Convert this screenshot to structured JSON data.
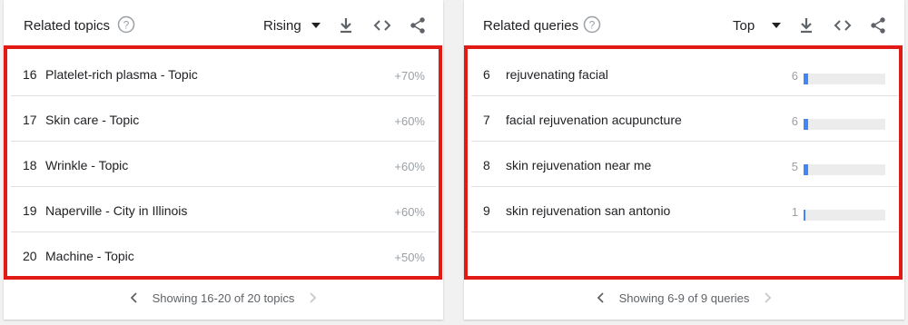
{
  "topics": {
    "title": "Related topics",
    "filter": "Rising",
    "rows": [
      {
        "index": "16",
        "label": "Platelet-rich plasma - Topic",
        "value": "+70%"
      },
      {
        "index": "17",
        "label": "Skin care - Topic",
        "value": "+60%"
      },
      {
        "index": "18",
        "label": "Wrinkle - Topic",
        "value": "+60%"
      },
      {
        "index": "19",
        "label": "Naperville - City in Illinois",
        "value": "+60%"
      },
      {
        "index": "20",
        "label": "Machine - Topic",
        "value": "+50%"
      }
    ],
    "pager_text": "Showing 16-20 of 20 topics"
  },
  "queries": {
    "title": "Related queries",
    "filter": "Top",
    "rows": [
      {
        "index": "6",
        "label": "rejuvenating facial",
        "value": "6",
        "bar": 0.06
      },
      {
        "index": "7",
        "label": "facial rejuvenation acupuncture",
        "value": "6",
        "bar": 0.06
      },
      {
        "index": "8",
        "label": "skin rejuvenation near me",
        "value": "5",
        "bar": 0.05
      },
      {
        "index": "9",
        "label": "skin rejuvenation san antonio",
        "value": "1",
        "bar": 0.01
      }
    ],
    "pager_text": "Showing 6-9 of 9 queries"
  },
  "colors": {
    "highlight": "#e21a16",
    "bar": "#4285f4",
    "bar_track": "#ececec"
  },
  "icons": {
    "help": "help-circle-icon",
    "caret": "caret-down-icon",
    "download": "download-icon",
    "embed": "embed-code-icon",
    "share": "share-icon",
    "prev": "chevron-left-icon",
    "next": "chevron-right-icon"
  }
}
